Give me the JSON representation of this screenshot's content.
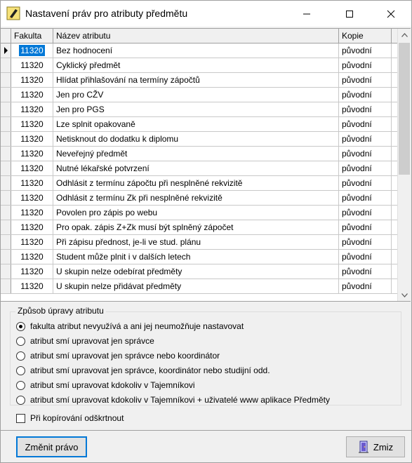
{
  "window": {
    "title": "Nastavení práv pro atributy předmětu",
    "icon": "pencil-app-icon"
  },
  "grid": {
    "columns": [
      "Fakulta",
      "Název atributu",
      "Kopie"
    ],
    "rows": [
      {
        "fakulta": "11320",
        "nazev": "Bez hodnocení",
        "kopie": "původní"
      },
      {
        "fakulta": "11320",
        "nazev": "Cyklický předmět",
        "kopie": "původní"
      },
      {
        "fakulta": "11320",
        "nazev": "Hlídat přihlašování na termíny zápočtů",
        "kopie": "původní"
      },
      {
        "fakulta": "11320",
        "nazev": "Jen pro CŽV",
        "kopie": "původní"
      },
      {
        "fakulta": "11320",
        "nazev": "Jen pro PGS",
        "kopie": "původní"
      },
      {
        "fakulta": "11320",
        "nazev": "Lze splnit opakovaně",
        "kopie": "původní"
      },
      {
        "fakulta": "11320",
        "nazev": "Netisknout do dodatku k diplomu",
        "kopie": "původní"
      },
      {
        "fakulta": "11320",
        "nazev": "Neveřejný předmět",
        "kopie": "původní"
      },
      {
        "fakulta": "11320",
        "nazev": "Nutné lékařské potvrzení",
        "kopie": "původní"
      },
      {
        "fakulta": "11320",
        "nazev": "Odhlásit z termínu zápočtu při nesplněné rekvizitě",
        "kopie": "původní"
      },
      {
        "fakulta": "11320",
        "nazev": "Odhlásit z termínu Zk při nesplněné rekvizitě",
        "kopie": "původní"
      },
      {
        "fakulta": "11320",
        "nazev": "Povolen pro zápis po webu",
        "kopie": "původní"
      },
      {
        "fakulta": "11320",
        "nazev": "Pro opak. zápis Z+Zk musí být splněný zápočet",
        "kopie": "původní"
      },
      {
        "fakulta": "11320",
        "nazev": "Při zápisu přednost, je-li ve stud. plánu",
        "kopie": "původní"
      },
      {
        "fakulta": "11320",
        "nazev": "Student může plnit i v dalších letech",
        "kopie": "původní"
      },
      {
        "fakulta": "11320",
        "nazev": "U skupin nelze odebírat předměty",
        "kopie": "původní"
      },
      {
        "fakulta": "11320",
        "nazev": "U skupin nelze přidávat předměty",
        "kopie": "původní"
      }
    ]
  },
  "group": {
    "title": "Způsob úpravy atributu",
    "options": [
      "fakulta atribut nevyužívá a ani jej neumožňuje nastavovat",
      "atribut smí upravovat jen správce",
      "atribut smí upravovat jen správce nebo koordinátor",
      "atribut smí upravovat jen správce, koordinátor nebo studijní odd.",
      "atribut smí upravovat kdokoliv v Tajemníkovi",
      "atribut smí upravovat kdokoliv v Tajemníkovi + uživatelé www aplikace Předměty"
    ],
    "selected_index": 0
  },
  "checkbox": {
    "label": "Při kopírování odškrtnout",
    "checked": false
  },
  "buttons": {
    "change": "Změnit právo",
    "close": "Zmiz"
  }
}
